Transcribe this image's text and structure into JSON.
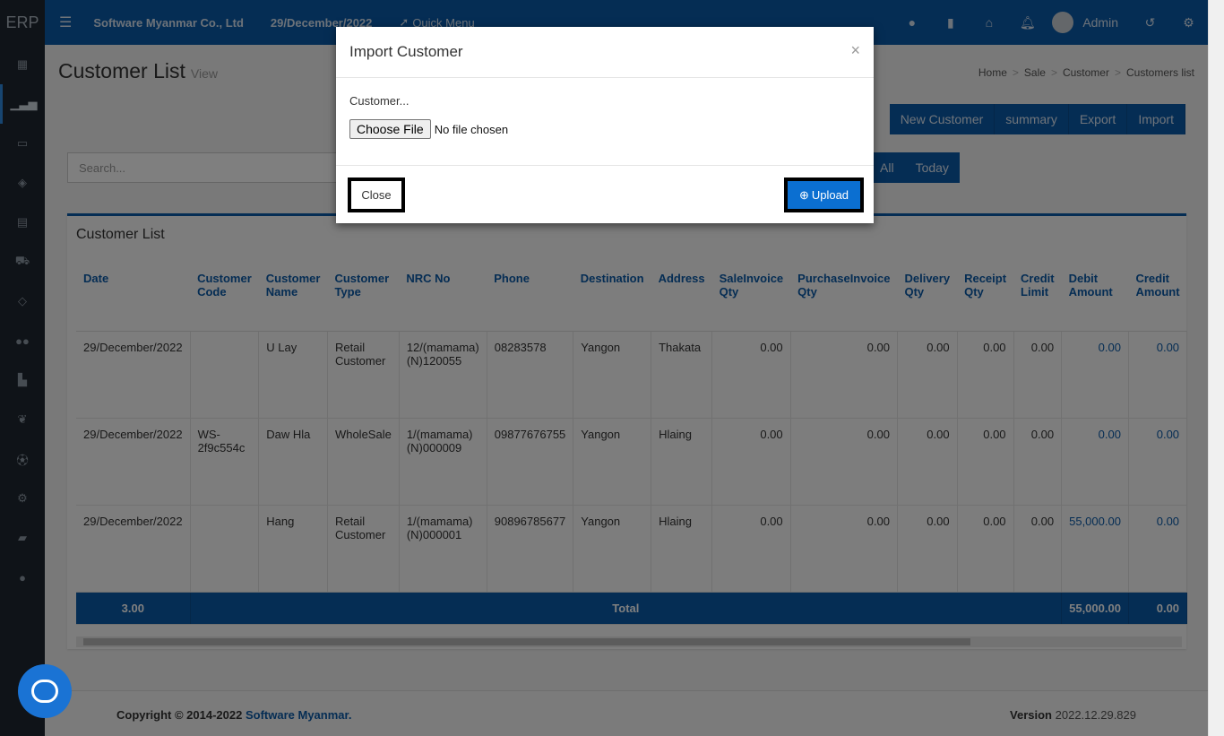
{
  "app": {
    "logo": "ERP",
    "company": "Software Myanmar Co., Ltd",
    "date": "29/December/2022",
    "quick_menu": "Quick Menu",
    "user": "Admin"
  },
  "page": {
    "title": "Customer List",
    "subtitle": "View"
  },
  "breadcrumb": [
    "Home",
    "Sale",
    "Customer",
    "Customers list"
  ],
  "actions": [
    "New Customer",
    "summary",
    "Export",
    "Import"
  ],
  "search": {
    "placeholder": "Search..."
  },
  "filters": [
    "All",
    "Today"
  ],
  "panel_title": "Customer List",
  "table": {
    "headers": [
      "Date",
      "Customer Code",
      "Customer Name",
      "Customer Type",
      "NRC No",
      "Phone",
      "Destination",
      "Address",
      "SaleInvoice Qty",
      "PurchaseInvoice Qty",
      "Delivery Qty",
      "Receipt Qty",
      "Credit Limit",
      "Debit Amount",
      "Credit Amount"
    ],
    "rows": [
      [
        "29/December/2022",
        "",
        "U Lay",
        "Retail Customer",
        "12/(mamama)(N)120055",
        "08283578",
        "Yangon",
        "Thakata",
        "0.00",
        "0.00",
        "0.00",
        "0.00",
        "0.00",
        "0.00",
        "0.00"
      ],
      [
        "29/December/2022",
        "WS-2f9c554c",
        "Daw Hla",
        "WholeSale",
        "1/(mamama)(N)000009",
        "09877676755",
        "Yangon",
        "Hlaing",
        "0.00",
        "0.00",
        "0.00",
        "0.00",
        "0.00",
        "0.00",
        "0.00"
      ],
      [
        "29/December/2022",
        "",
        "Hang",
        "Retail Customer",
        "1/(mamama)(N)000001",
        "90896785677",
        "Yangon",
        "Hlaing",
        "0.00",
        "0.00",
        "0.00",
        "0.00",
        "0.00",
        "55,000.00",
        "0.00"
      ]
    ],
    "footer": {
      "count": "3.00",
      "label": "Total",
      "debit": "55,000.00",
      "credit": "0.00"
    }
  },
  "footer": {
    "copyright": "Copyright © 2014-2022",
    "company_link": "Software Myanmar.",
    "version_label": "Version",
    "version": "2022.12.29.829"
  },
  "modal": {
    "title": "Import Customer",
    "close_x": "×",
    "label": "Customer...",
    "choose_file": "Choose File",
    "no_file": "No file chosen",
    "close_button": "Close",
    "upload_button": "Upload"
  },
  "icons": {
    "rocket": "rocket-icon",
    "upload": "upload-icon"
  },
  "colors": {
    "primary": "#0b5aa8",
    "sidebar": "#1f2730",
    "upload": "#0b6fd1"
  }
}
